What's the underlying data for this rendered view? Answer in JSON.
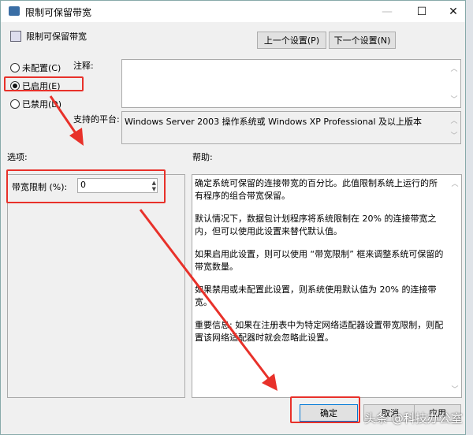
{
  "window": {
    "title": "限制可保留带宽",
    "minimize": "—",
    "maximize": "☐",
    "close": "✕"
  },
  "header": {
    "policy_name": "限制可保留带宽",
    "prev_button": "上一个设置(P)",
    "next_button": "下一个设置(N)"
  },
  "radios": [
    {
      "label": "未配置(C)",
      "checked": false
    },
    {
      "label": "已启用(E)",
      "checked": true
    },
    {
      "label": "已禁用(D)",
      "checked": false
    }
  ],
  "comment": {
    "label": "注释:",
    "value": ""
  },
  "platform": {
    "label": "支持的平台:",
    "value": "Windows Server 2003 操作系统或 Windows XP Professional 及以上版本"
  },
  "options": {
    "label": "选项:",
    "field_label": "带宽限制 (%):",
    "field_value": "0"
  },
  "help": {
    "label": "帮助:",
    "paragraphs": [
      "确定系统可保留的连接带宽的百分比。此值限制系统上运行的所有程序的组合带宽保留。",
      "默认情况下，数据包计划程序将系统限制在 20% 的连接带宽之内，但可以使用此设置来替代默认值。",
      "如果启用此设置，则可以使用 “带宽限制” 框来调整系统可保留的带宽数量。",
      "如果禁用或未配置此设置，则系统使用默认值为 20% 的连接带宽。",
      "重要信息: 如果在注册表中为特定网络适配器设置带宽限制，则配置该网络适配器时就会忽略此设置。"
    ]
  },
  "footer": {
    "ok": "确定",
    "cancel": "取消",
    "apply": "应用"
  },
  "watermark": "头条 @科技办公室",
  "annotation_color": "#e8312a"
}
